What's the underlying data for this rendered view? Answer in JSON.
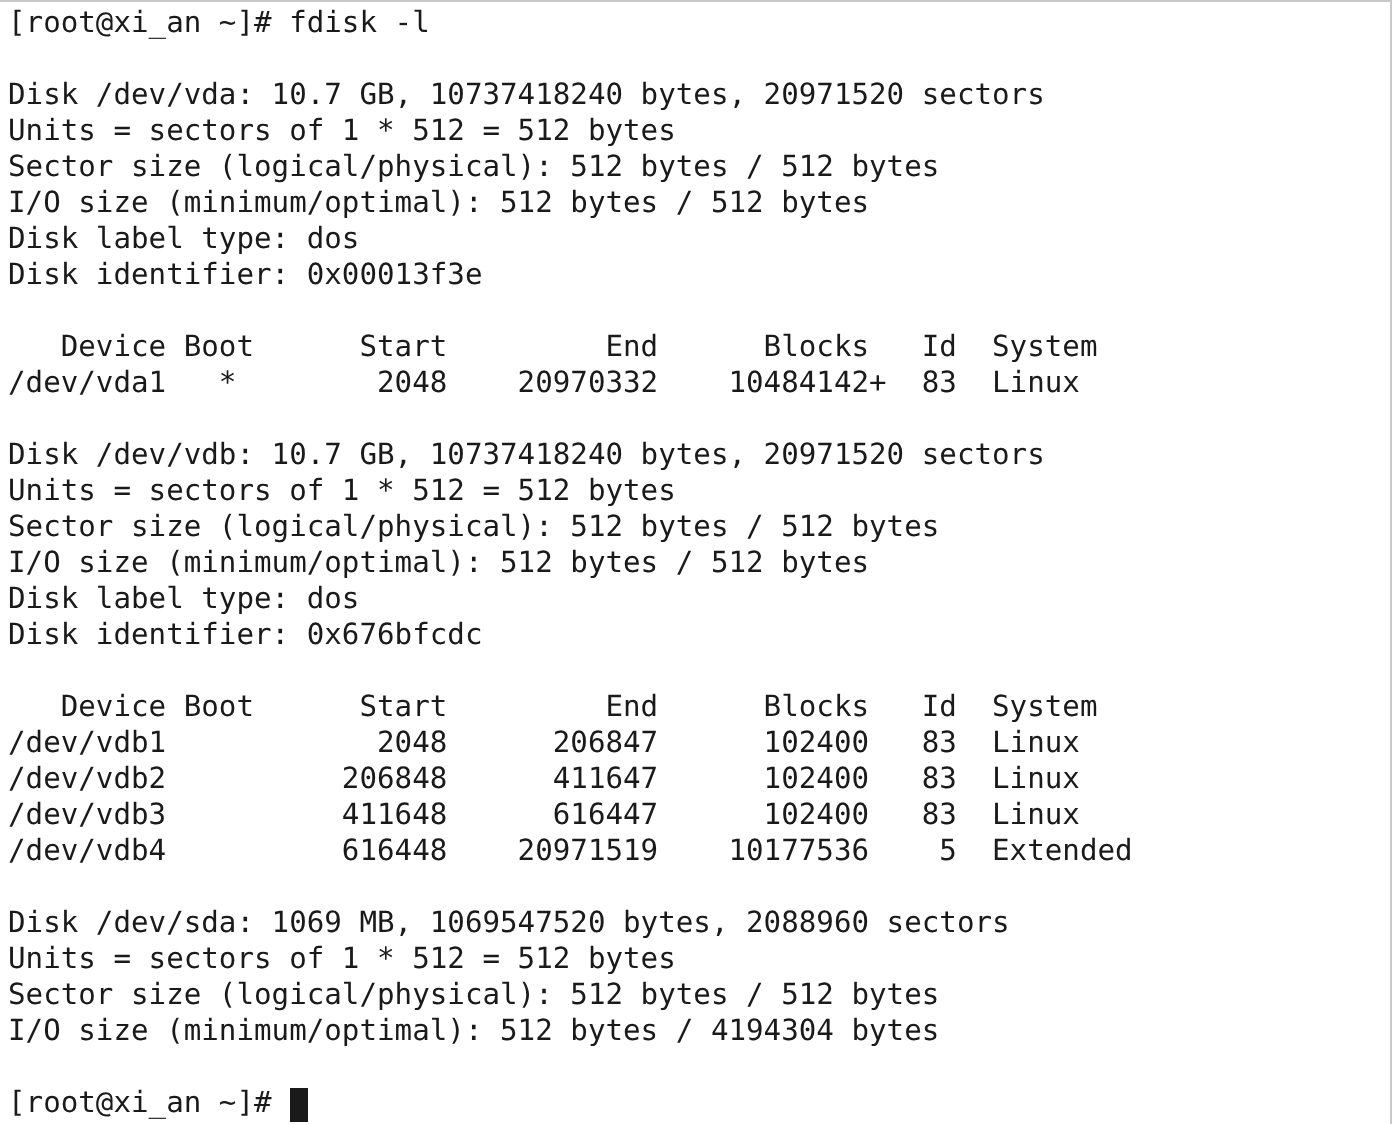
{
  "terminal": {
    "blocks": [
      {
        "lines": [
          "[root@xi_an ~]# fdisk -l"
        ]
      },
      {
        "lines": [
          "Disk /dev/vda: 10.7 GB, 10737418240 bytes, 20971520 sectors",
          "Units = sectors of 1 * 512 = 512 bytes",
          "Sector size (logical/physical): 512 bytes / 512 bytes",
          "I/O size (minimum/optimal): 512 bytes / 512 bytes",
          "Disk label type: dos",
          "Disk identifier: 0x00013f3e"
        ]
      },
      {
        "lines": [
          "   Device Boot      Start         End      Blocks   Id  System",
          "/dev/vda1   *        2048    20970332    10484142+  83  Linux"
        ]
      },
      {
        "lines": [
          "Disk /dev/vdb: 10.7 GB, 10737418240 bytes, 20971520 sectors",
          "Units = sectors of 1 * 512 = 512 bytes",
          "Sector size (logical/physical): 512 bytes / 512 bytes",
          "I/O size (minimum/optimal): 512 bytes / 512 bytes",
          "Disk label type: dos",
          "Disk identifier: 0x676bfcdc"
        ]
      },
      {
        "lines": [
          "   Device Boot      Start         End      Blocks   Id  System",
          "/dev/vdb1            2048      206847      102400   83  Linux",
          "/dev/vdb2          206848      411647      102400   83  Linux",
          "/dev/vdb3          411648      616447      102400   83  Linux",
          "/dev/vdb4          616448    20971519    10177536    5  Extended"
        ]
      },
      {
        "lines": [
          "Disk /dev/sda: 1069 MB, 1069547520 bytes, 2088960 sectors",
          "Units = sectors of 1 * 512 = 512 bytes",
          "Sector size (logical/physical): 512 bytes / 512 bytes",
          "I/O size (minimum/optimal): 512 bytes / 4194304 bytes"
        ]
      }
    ],
    "prompt": {
      "text": "[root@xi_an ~]# ",
      "cursor": true
    }
  }
}
